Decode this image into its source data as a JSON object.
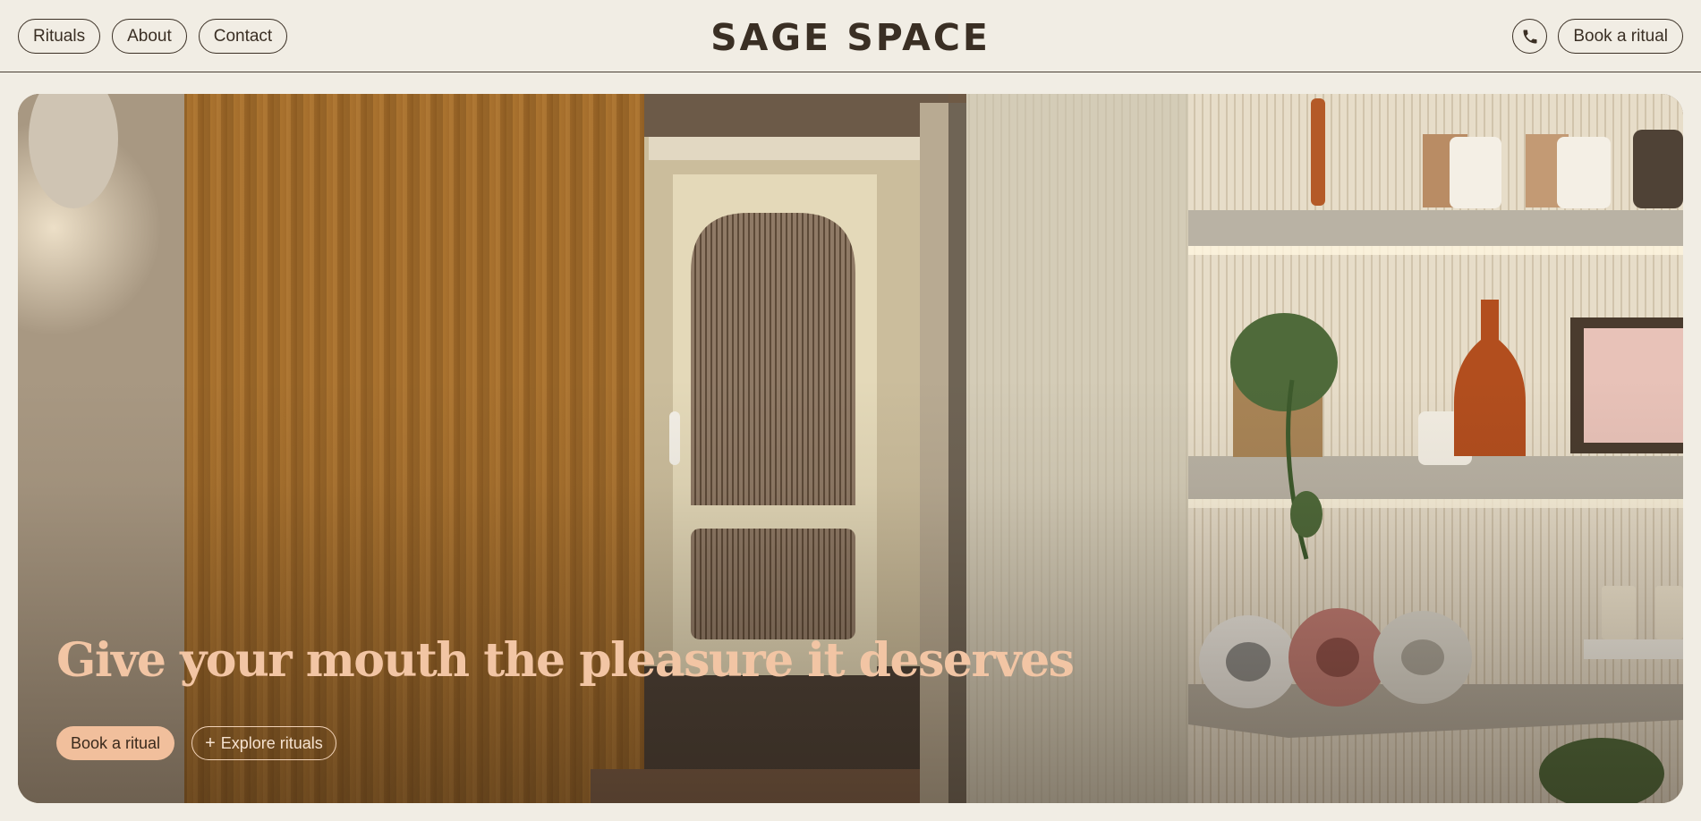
{
  "header": {
    "nav": [
      {
        "label": "Rituals"
      },
      {
        "label": "About"
      },
      {
        "label": "Contact"
      }
    ],
    "logo": "SAGE SPACE",
    "phone_icon": "phone-icon",
    "book_label": "Book a ritual"
  },
  "hero": {
    "image": "spa-interior-photo",
    "headline": "Give your mouth the pleasure it deserves",
    "primary_cta": "Book a ritual",
    "secondary_cta_icon": "+",
    "secondary_cta": "Explore rituals"
  },
  "colors": {
    "background": "#f1ede4",
    "text": "#3a2f24",
    "headline": "#f2c5a4",
    "cta_primary": "#f1bf9c"
  }
}
